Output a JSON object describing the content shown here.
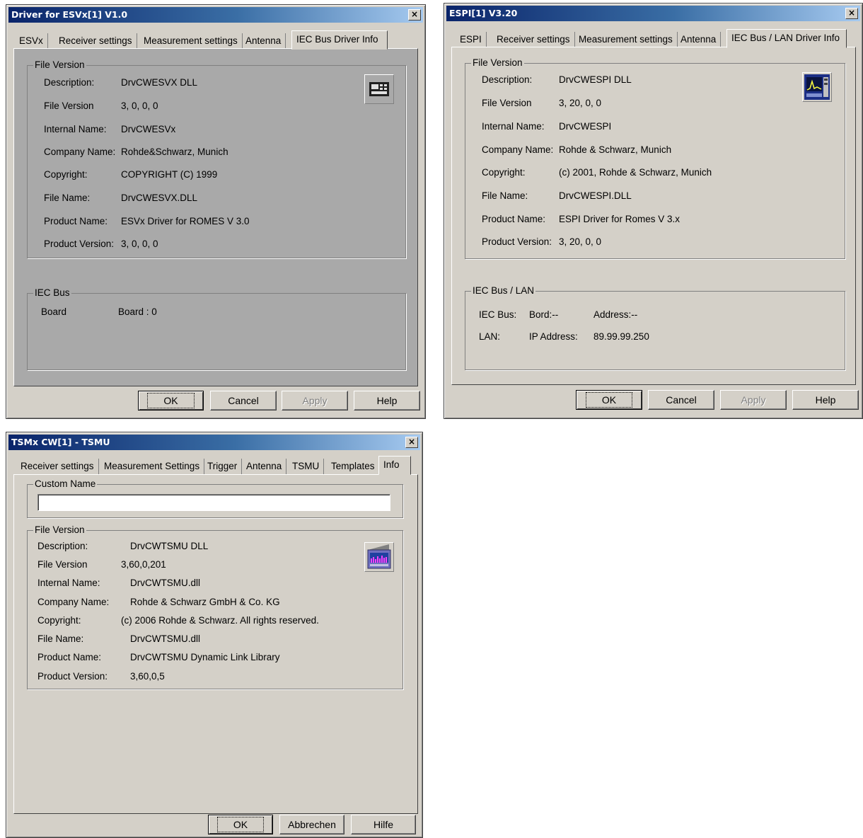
{
  "win1": {
    "title": "Driver for ESVx[1] V1.0",
    "close": "×",
    "tabs": [
      "ESVx",
      "Receiver settings",
      "Measurement settings",
      "Antenna",
      "IEC Bus Driver Info"
    ],
    "file_group": "File Version",
    "rows": [
      {
        "label": "Description:",
        "value": "DrvCWESVX DLL"
      },
      {
        "label": "File Version",
        "value": "3, 0, 0, 0"
      },
      {
        "label": "Internal Name:",
        "value": "DrvCWESVx"
      },
      {
        "label": "Company Name:",
        "value": "Rohde&Schwarz, Munich"
      },
      {
        "label": "Copyright:",
        "value": "COPYRIGHT (C) 1999"
      },
      {
        "label": "File Name:",
        "value": "DrvCWESVX.DLL"
      },
      {
        "label": "Product Name:",
        "value": "ESVx Driver for ROMES V 3.0"
      },
      {
        "label": "Product Version:",
        "value": "3, 0, 0, 0"
      }
    ],
    "bus_group": "IEC Bus",
    "board_label": "Board",
    "board_value": "Board : 0",
    "buttons": {
      "ok": "OK",
      "cancel": "Cancel",
      "apply": "Apply",
      "help": "Help"
    }
  },
  "win2": {
    "title": "ESPI[1] V3.20",
    "close": "×",
    "tabs": [
      "ESPI",
      "Receiver settings",
      "Measurement settings",
      "Antenna",
      "IEC Bus / LAN Driver Info"
    ],
    "file_group": "File Version",
    "rows": [
      {
        "label": "Description:",
        "value": "DrvCWESPI DLL"
      },
      {
        "label": "File Version",
        "value": "3, 20, 0, 0"
      },
      {
        "label": "Internal Name:",
        "value": "DrvCWESPI"
      },
      {
        "label": "Company Name:",
        "value": "Rohde & Schwarz, Munich"
      },
      {
        "label": "Copyright:",
        "value": "(c) 2001, Rohde & Schwarz, Munich"
      },
      {
        "label": "File Name:",
        "value": "DrvCWESPI.DLL"
      },
      {
        "label": "Product Name:",
        "value": "ESPI Driver for Romes V 3.x"
      },
      {
        "label": "Product Version:",
        "value": "3, 20, 0, 0"
      }
    ],
    "bus_group": "IEC Bus / LAN",
    "iec_label": "IEC Bus:",
    "bord": "Bord:--",
    "address": "Address:--",
    "lan_label": "LAN:",
    "ip_label": "IP Address:",
    "ip_value": "89.99.99.250",
    "buttons": {
      "ok": "OK",
      "cancel": "Cancel",
      "apply": "Apply",
      "help": "Help"
    }
  },
  "win3": {
    "title": "TSMx CW[1] - TSMU",
    "close": "×",
    "tabs": [
      "Receiver settings",
      "Measurement Settings",
      "Trigger",
      "Antenna",
      "TSMU",
      "Templates",
      "Info"
    ],
    "custom_group": "Custom Name",
    "custom_value": "",
    "file_group": "File Version",
    "rows": [
      {
        "label": "Description:",
        "value": "DrvCWTSMU DLL"
      },
      {
        "label": "File Version",
        "value": "3,60,0,201"
      },
      {
        "label": "Internal Name:",
        "value": "DrvCWTSMU.dll"
      },
      {
        "label": "Company Name:",
        "value": "Rohde & Schwarz GmbH & Co. KG"
      },
      {
        "label": "Copyright:",
        "value": "(c) 2006 Rohde & Schwarz. All rights reserved."
      },
      {
        "label": "File Name:",
        "value": "DrvCWTSMU.dll"
      },
      {
        "label": "Product Name:",
        "value": "DrvCWTSMU Dynamic Link Library"
      },
      {
        "label": "Product Version:",
        "value": "3,60,0,5"
      }
    ],
    "buttons": {
      "ok": "OK",
      "cancel": "Abbrechen",
      "help": "Hilfe"
    }
  }
}
